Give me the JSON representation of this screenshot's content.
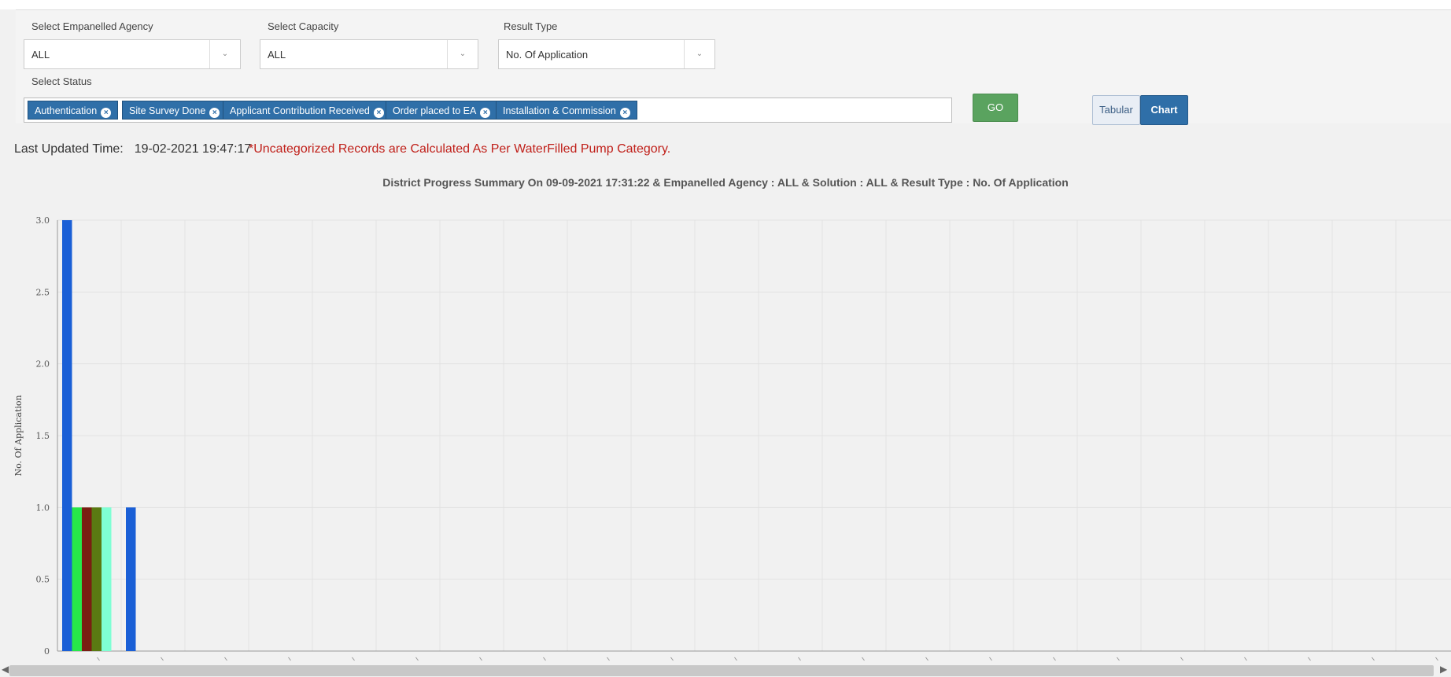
{
  "filters": {
    "agency": {
      "label": "Select Empanelled Agency",
      "value": "ALL"
    },
    "capacity": {
      "label": "Select Capacity",
      "value": "ALL"
    },
    "result_type": {
      "label": "Result Type",
      "value": "No. Of Application"
    },
    "status": {
      "label": "Select Status",
      "tags": [
        "Authentication",
        "Site Survey Done",
        "Applicant Contribution Received",
        "Order placed to EA",
        "Installation & Commission"
      ]
    },
    "go_label": "GO",
    "view_tabs": {
      "tabular": "Tabular",
      "chart": "Chart",
      "active": "Chart"
    }
  },
  "info": {
    "last_updated_label": "Last Updated Time:",
    "last_updated_value": "19-02-2021 19:47:17",
    "note": "*Uncategorized Records are Calculated As Per WaterFilled Pump Category."
  },
  "icons": {
    "tag_remove": "close-circle-icon",
    "dropdown": "chevron-down-icon",
    "scroll_left": "arrow-left-icon",
    "scroll_right": "arrow-right-icon"
  },
  "colors": {
    "tag_bg": "#2f6fa8",
    "go_button": "#5aa35f",
    "note_text": "#c0201a",
    "series": [
      "#1a5fd6",
      "#27e84a",
      "#7a1e12",
      "#5a7a12",
      "#7fffd4"
    ]
  },
  "chart_data": {
    "type": "bar",
    "title": "District Progress Summary On 09-09-2021 17:31:22 & Empanelled Agency : ALL & Solution : ALL & Result Type : No. Of Application",
    "ylabel": "No. Of Application",
    "xlabel": "",
    "ylim": [
      0,
      3
    ],
    "yticks": [
      0,
      0.5,
      1.0,
      1.5,
      2.0,
      2.5,
      3.0
    ],
    "grid": true,
    "category_count": 22,
    "series": [
      {
        "values": [
          3,
          1,
          0,
          0,
          0,
          0,
          0,
          0,
          0,
          0,
          0,
          0,
          0,
          0,
          0,
          0,
          0,
          0,
          0,
          0,
          0,
          0
        ]
      },
      {
        "values": [
          1,
          0,
          0,
          0,
          0,
          0,
          0,
          0,
          0,
          0,
          0,
          0,
          0,
          0,
          0,
          0,
          0,
          0,
          0,
          0,
          0,
          0
        ]
      },
      {
        "values": [
          1,
          0,
          0,
          0,
          0,
          0,
          0,
          0,
          0,
          0,
          0,
          0,
          0,
          0,
          0,
          0,
          0,
          0,
          0,
          0,
          0,
          0
        ]
      },
      {
        "values": [
          1,
          0,
          0,
          0,
          0,
          0,
          0,
          0,
          0,
          0,
          0,
          0,
          0,
          0,
          0,
          0,
          0,
          0,
          0,
          0,
          0,
          0
        ]
      },
      {
        "values": [
          1,
          0,
          0,
          0,
          0,
          0,
          0,
          0,
          0,
          0,
          0,
          0,
          0,
          0,
          0,
          0,
          0,
          0,
          0,
          0,
          0,
          0
        ]
      }
    ]
  }
}
